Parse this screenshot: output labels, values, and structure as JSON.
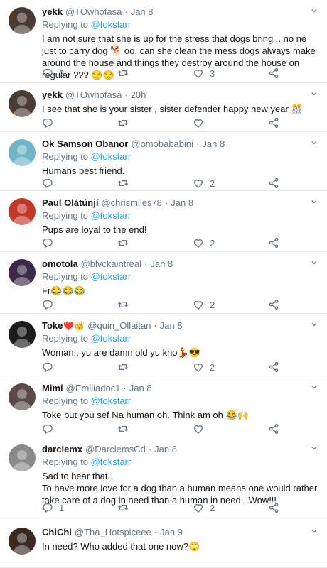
{
  "tweets": [
    {
      "name": "yekk",
      "badge": "",
      "handle": "@TOwhofasa",
      "dot": "·",
      "time": "Jan 8",
      "reply_prefix": "",
      "reply_to": "",
      "reply_full": "Replying to @tokstarr",
      "text": "I am not sure that she is up for the stress that dogs bring .. no ne just to carry dog 🐕 oo, can she clean the mess dogs always make around the house and things they destroy around the house on regular ??? 😒😒",
      "replies": "2",
      "retweets": "",
      "likes": "3",
      "avatar_color": "#4a3b33",
      "avatar_icon": "avatar-photo"
    },
    {
      "name": "yekk",
      "badge": "",
      "handle": "@TOwhofasa",
      "dot": "·",
      "time": "20h",
      "reply_prefix": "",
      "reply_to": "",
      "reply_full": "",
      "text": "I see that she is your sister , sister defender happy new year 🎊",
      "replies": "",
      "retweets": "",
      "likes": "",
      "avatar_color": "#4a3b33",
      "avatar_icon": "avatar-photo"
    },
    {
      "name": "Ok Samson Obanor",
      "badge": "",
      "handle": "@omobababini",
      "dot": "·",
      "time": "Jan 8",
      "reply_prefix": "Replying to",
      "reply_to": "@tokstarr",
      "reply_full": "",
      "text": "Humans best friend.",
      "replies": "",
      "retweets": "",
      "likes": "2",
      "avatar_color": "#6fb6c7",
      "avatar_icon": "avatar-photo"
    },
    {
      "name": "Paul Olátúnjí",
      "badge": "",
      "handle": "@chrismiles78",
      "dot": "·",
      "time": "Jan 8",
      "reply_prefix": "Replying to",
      "reply_to": "@tokstarr",
      "reply_full": "",
      "text": "Pups are loyal to the end!",
      "replies": "",
      "retweets": "",
      "likes": "2",
      "avatar_color": "#c0392b",
      "avatar_icon": "avatar-photo"
    },
    {
      "name": "omotola",
      "badge": "",
      "handle": "@blvckaintreal",
      "dot": "·",
      "time": "Jan 8",
      "reply_prefix": "Replying to",
      "reply_to": "@tokstarr",
      "reply_full": "",
      "text": "Fr😂😂😂",
      "replies": "",
      "retweets": "",
      "likes": "2",
      "avatar_color": "#3d2a4a",
      "avatar_icon": "avatar-photo"
    },
    {
      "name": "Toke",
      "badge": "❤️👑",
      "handle": "@quin_Ollaitan",
      "dot": "·",
      "time": "Jan 8",
      "reply_prefix": "Replying to",
      "reply_to": "@tokstarr",
      "reply_full": "",
      "text": "Woman,, yu are damn old yu kno💃😎",
      "replies": "",
      "retweets": "",
      "likes": "2",
      "avatar_color": "#1c1c1c",
      "avatar_icon": "avatar-photo"
    },
    {
      "name": "Mimi",
      "badge": "",
      "handle": "@Emiliadoc1",
      "dot": "·",
      "time": "Jan 8",
      "reply_prefix": "Replying to",
      "reply_to": "@tokstarr",
      "reply_full": "",
      "text": "Toke but you sef Na human oh. Think am oh 😂🙌",
      "replies": "",
      "retweets": "",
      "likes": "",
      "avatar_color": "#5a4a44",
      "avatar_icon": "avatar-photo"
    },
    {
      "name": "darclemx",
      "badge": "",
      "handle": "@DarclemsCd",
      "dot": "·",
      "time": "Jan 8",
      "reply_prefix": "Replying to",
      "reply_to": "@tokstarr",
      "reply_full": "",
      "text": "Sad to hear that...\nTo have more love for a dog than a human means one would rather take care of a dog in need than a human in need...Wow!!!",
      "replies": "1",
      "retweets": "",
      "likes": "2",
      "avatar_color": "#8a8a8a",
      "avatar_icon": "avatar-photo"
    },
    {
      "name": "ChiChi",
      "badge": "",
      "handle": "@Tha_Hotspiceee",
      "dot": "·",
      "time": "Jan 9",
      "reply_prefix": "",
      "reply_to": "",
      "reply_full": "",
      "text": "In need? Who added that one now?🙄",
      "replies": "",
      "retweets": "",
      "likes": "",
      "avatar_color": "#3b2a22",
      "avatar_icon": "avatar-photo"
    }
  ],
  "icons": {
    "reply": "reply-icon",
    "retweet": "retweet-icon",
    "like": "heart-icon",
    "share": "share-icon",
    "more": "chevron-down-icon"
  },
  "colors": {
    "text": "#14171a",
    "muted": "#657786",
    "link": "#1da1f2",
    "divider": "#e6ecf0"
  }
}
